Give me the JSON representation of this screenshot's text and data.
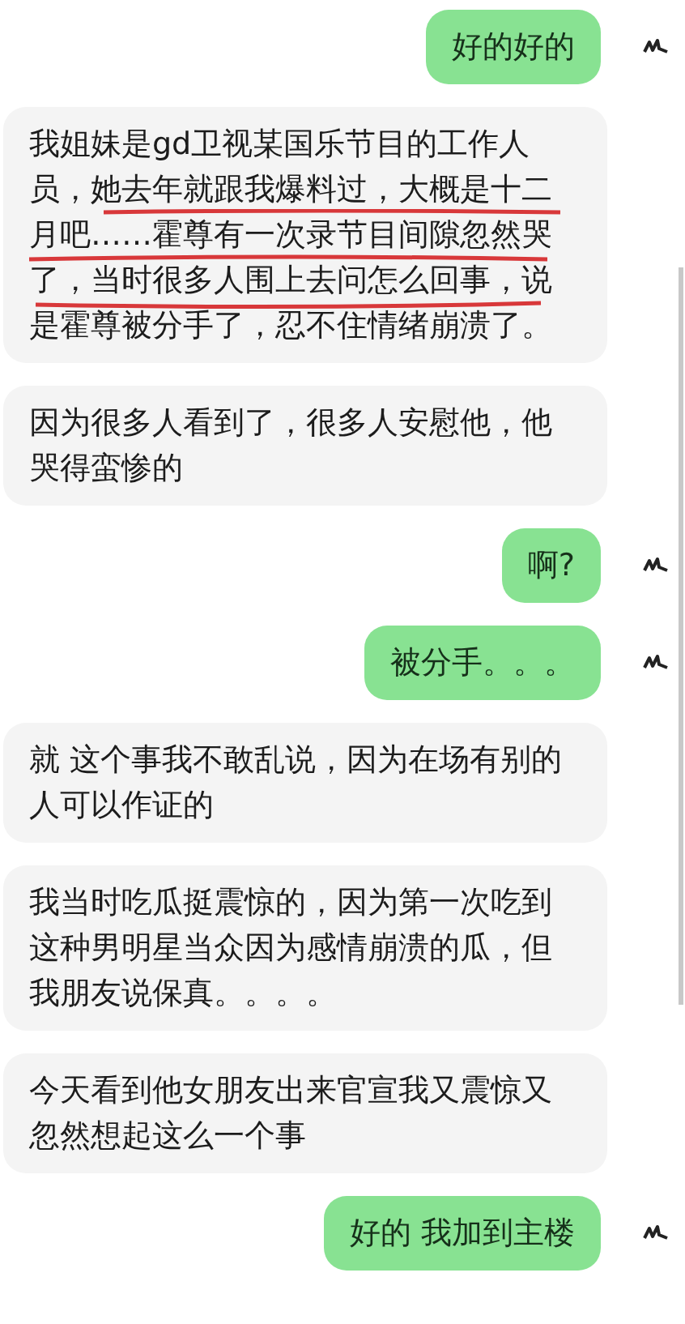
{
  "messages": [
    {
      "kind": "outgoing",
      "text": "好的好的",
      "annotated": false
    },
    {
      "kind": "incoming",
      "text": "我姐妹是gd卫视某国乐节目的工作人员，她去年就跟我爆料过，大概是十二月吧……霍尊有一次录节目间隙忽然哭了，当时很多人围上去问怎么回事，说是霍尊被分手了，忍不住情绪崩溃了。",
      "annotated": true
    },
    {
      "kind": "incoming",
      "text": "因为很多人看到了，很多人安慰他，他哭得蛮惨的",
      "annotated": false
    },
    {
      "kind": "outgoing",
      "text": "啊?",
      "annotated": false
    },
    {
      "kind": "outgoing",
      "text": "被分手。。。",
      "annotated": false
    },
    {
      "kind": "incoming",
      "text": "就 这个事我不敢乱说，因为在场有别的人可以作证的",
      "annotated": false
    },
    {
      "kind": "incoming",
      "text": "我当时吃瓜挺震惊的，因为第一次吃到这种男明星当众因为感情崩溃的瓜，但我朋友说保真。。。。",
      "annotated": false
    },
    {
      "kind": "incoming",
      "text": "今天看到他女朋友出来官宣我又震惊又忽然想起这么一个事",
      "annotated": false
    },
    {
      "kind": "outgoing",
      "text": "好的 我加到主楼",
      "annotated": false
    }
  ]
}
